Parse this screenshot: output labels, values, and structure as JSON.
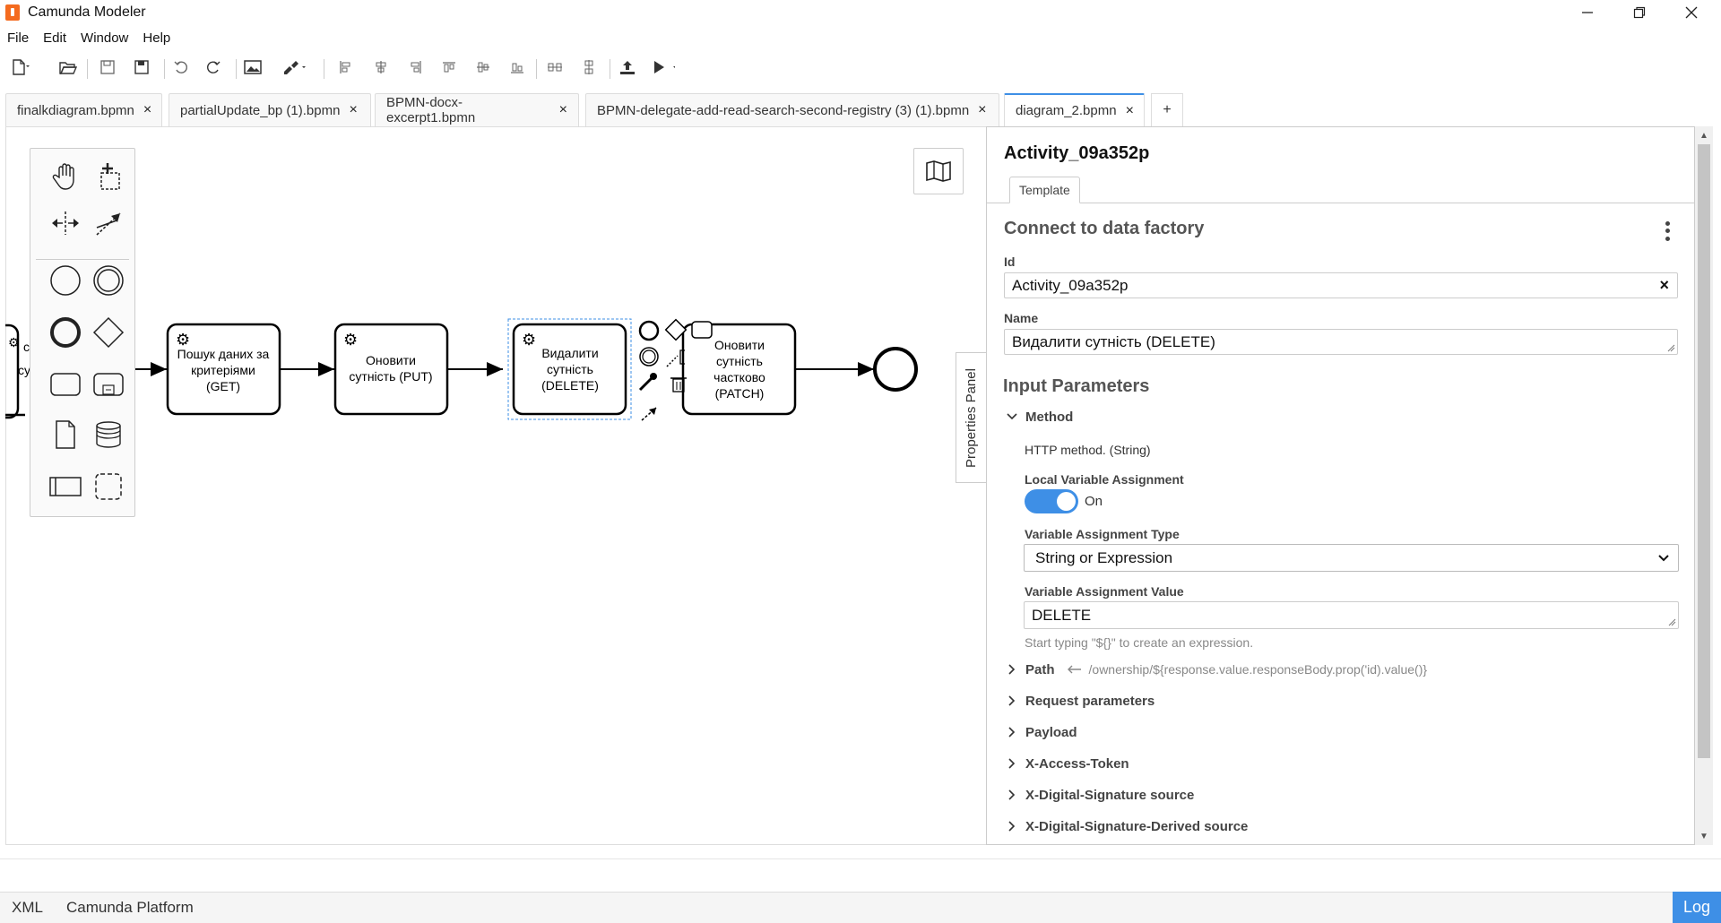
{
  "window": {
    "title": "Camunda Modeler"
  },
  "menu": [
    "File",
    "Edit",
    "Window",
    "Help"
  ],
  "tabs": [
    {
      "label": "finalkdiagram.bpmn",
      "active": false
    },
    {
      "label": "partialUpdate_bp (1).bpmn",
      "active": false
    },
    {
      "label": "BPMN-docx-excerpt1.bpmn",
      "active": false
    },
    {
      "label": "BPMN-delegate-add-read-search-second-registry (3) (1).bpmn",
      "active": false
    },
    {
      "label": "diagram_2.bpmn",
      "active": true
    }
  ],
  "tab_add": "+",
  "diagram": {
    "tasks": [
      {
        "label_lines": [
          "Пошук даних за",
          "критеріями",
          "(GET)"
        ]
      },
      {
        "label_lines": [
          "Оновити",
          "сутність (PUT)"
        ]
      },
      {
        "label_lines": [
          "Видалити",
          "сутність",
          "(DELETE)"
        ]
      },
      {
        "label_lines": [
          "Оновити",
          "сутність",
          "частково",
          "(PATCH)"
        ]
      }
    ],
    "partial_left_label": [
      "с",
      "су"
    ]
  },
  "properties_toggle_label": "Properties Panel",
  "properties": {
    "element_id_title": "Activity_09a352p",
    "tab_template": "Template",
    "section_title": "Connect to data factory",
    "id_label": "Id",
    "id_value": "Activity_09a352p",
    "id_clear": "×",
    "name_label": "Name",
    "name_value": "Видалити сутність (DELETE)",
    "group_title": "Input Parameters",
    "method": {
      "title": "Method",
      "description": "HTTP method. (String)",
      "local_var_label": "Local Variable Assignment",
      "toggle_text": "On",
      "toggle_on": true,
      "type_label": "Variable Assignment Type",
      "type_value": "String or Expression",
      "value_label": "Variable Assignment Value",
      "value": "DELETE",
      "hint": "Start typing \"${}\" to create an expression."
    },
    "collapsed_groups": [
      {
        "title": "Path",
        "preview": "/ownership/${response.value.responseBody.prop('id).value()}"
      },
      {
        "title": "Request parameters"
      },
      {
        "title": "Payload"
      },
      {
        "title": "X-Access-Token"
      },
      {
        "title": "X-Digital-Signature source"
      },
      {
        "title": "X-Digital-Signature-Derived source"
      }
    ]
  },
  "status": {
    "xml": "XML",
    "platform": "Camunda Platform",
    "log": "Log"
  },
  "colors": {
    "accent": "#3e8fe6",
    "app_icon": "#f46b1f",
    "selection": "#3e8fe6"
  }
}
